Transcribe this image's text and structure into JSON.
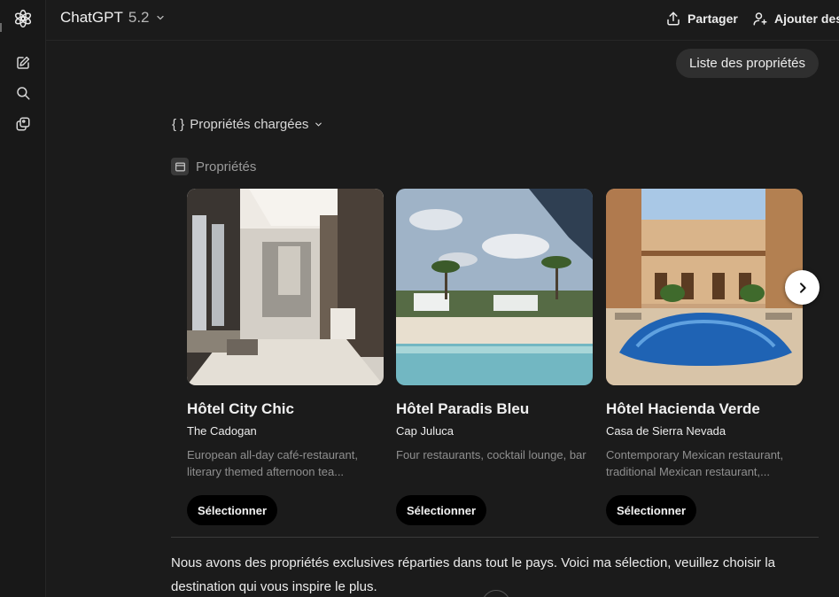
{
  "header": {
    "model_name": "ChatGPT",
    "model_version": "5.2",
    "share_label": "Partager",
    "add_label": "Ajouter des"
  },
  "sidebar": {
    "icons": [
      "openai-logo-icon",
      "new-chat-icon",
      "search-icon",
      "library-icon"
    ]
  },
  "chat": {
    "user_message": "Liste des propriétés",
    "tool_status": "Propriétés chargées",
    "tool_brace": "{ }",
    "widget_label": "Propriétés",
    "properties": [
      {
        "title": "Hôtel City Chic",
        "subtitle": "The Cadogan",
        "description": "European all-day café-restaurant, literary themed afternoon tea...",
        "button": "Sélectionner",
        "image": "hotel-lobby-image"
      },
      {
        "title": "Hôtel Paradis Bleu",
        "subtitle": "Cap Juluca",
        "description": "Four restaurants, cocktail lounge, bar",
        "button": "Sélectionner",
        "image": "beach-resort-image"
      },
      {
        "title": "Hôtel Hacienda Verde",
        "subtitle": "Casa de Sierra Nevada",
        "description": "Contemporary Mexican restaurant, traditional Mexican restaurant,...",
        "button": "Sélectionner",
        "image": "hacienda-pool-image"
      }
    ],
    "assistant_message": "Nous avons des propriétés exclusives réparties dans tout le pays. Voici ma sélection, veuillez choisir la destination qui vous inspire le plus."
  },
  "colors": {
    "background": "#1b1b1b",
    "pill": "#2f2f2f",
    "button": "#000000",
    "muted_text": "#8f8f8f"
  }
}
